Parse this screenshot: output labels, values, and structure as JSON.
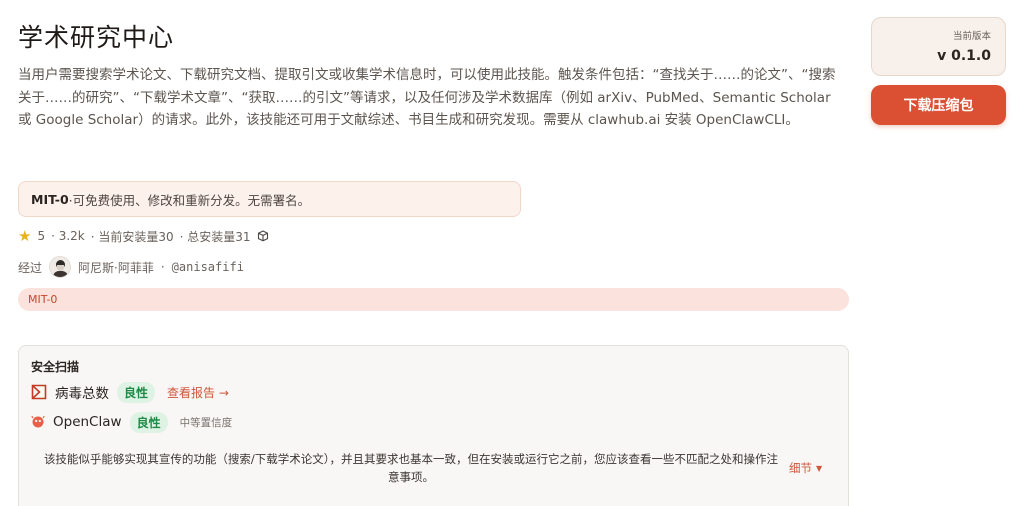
{
  "page": {
    "title": "学术研究中心",
    "description": "当用户需要搜索学术论文、下载研究文档、提取引文或收集学术信息时，可以使用此技能。触发条件包括：“查找关于……的论文”、“搜索关于……的研究”、“下载学术文章”、“获取……的引文”等请求，以及任何涉及学术数据库（例如 arXiv、PubMed、Semantic Scholar 或 Google Scholar）的请求。此外，该技能还可用于文献综述、书目生成和研究发现。需要从 clawhub.ai 安装 OpenClawCLI。"
  },
  "license": {
    "code": "MIT-0",
    "text": "·可免费使用、修改和重新分发。无需署名。"
  },
  "stats": {
    "stars": "5",
    "downloads": "· 3.2k",
    "current_installs": "· 当前安装量30",
    "total_installs": "· 总安装量31",
    "icons": {
      "star": "star-icon",
      "package": "package-icon"
    },
    "star_color": "#e8b21c"
  },
  "author": {
    "via": "经过",
    "name": "阿尼斯·阿菲菲",
    "separator": "·",
    "handle": "@anisafifi"
  },
  "tag": {
    "label": "MIT-0"
  },
  "security": {
    "title": "安全扫描",
    "virustotal": {
      "name": "病毒总数",
      "status": "良性",
      "link": "查看报告 →"
    },
    "openclaw": {
      "name": "OpenClaw",
      "status": "良性",
      "confidence": "中等置信度"
    },
    "note": "该技能似乎能够实现其宣传的功能（搜索/下载学术论文），并且其要求也基本一致，但在安装或运行它之前，您应该查看一些不匹配之处和操作注意事项。",
    "details": "细节"
  },
  "sidebar": {
    "version_label": "当前版本",
    "version": "v 0.1.0",
    "download_label": "下载压缩包"
  },
  "colors": {
    "accent": "#db4f32",
    "benign_bg": "#dff3e5",
    "benign_text": "#1f8a45",
    "tag_bg": "#fbe2dc"
  }
}
